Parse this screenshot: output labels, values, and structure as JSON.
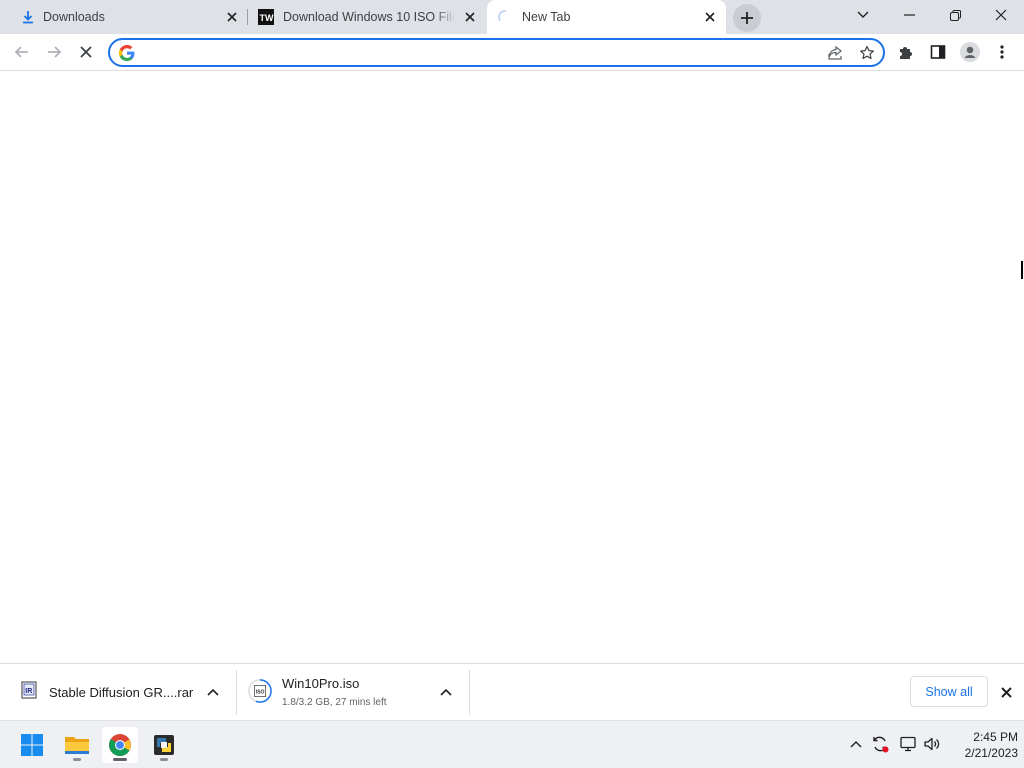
{
  "browser": {
    "tabs": [
      {
        "title": "Downloads",
        "icon": "download-icon",
        "active": false
      },
      {
        "title": "Download Windows 10 ISO File (",
        "icon": "tw-site-icon",
        "active": false
      },
      {
        "title": "New Tab",
        "icon": "loading-spinner-icon",
        "active": true
      }
    ],
    "toolbar": {
      "omnibox_value": "",
      "omnibox_placeholder": ""
    }
  },
  "downloads": {
    "items": [
      {
        "name": "Stable Diffusion GR....rar",
        "status": "",
        "icon": "rar-archive-icon"
      },
      {
        "name": "Win10Pro.iso",
        "status": "1.8/3.2 GB, 27 mins left",
        "icon": "iso-file-icon"
      }
    ],
    "show_all_label": "Show all"
  },
  "taskbar": {
    "apps": [
      "windows-start-icon",
      "file-explorer-icon",
      "chrome-icon",
      "python-app-icon"
    ],
    "clock": {
      "time": "2:45 PM",
      "date": "2/21/2023"
    }
  },
  "colors": {
    "accent": "#1a73e8",
    "tabstrip": "#dee1e6",
    "taskbar": "#eef0f4"
  }
}
